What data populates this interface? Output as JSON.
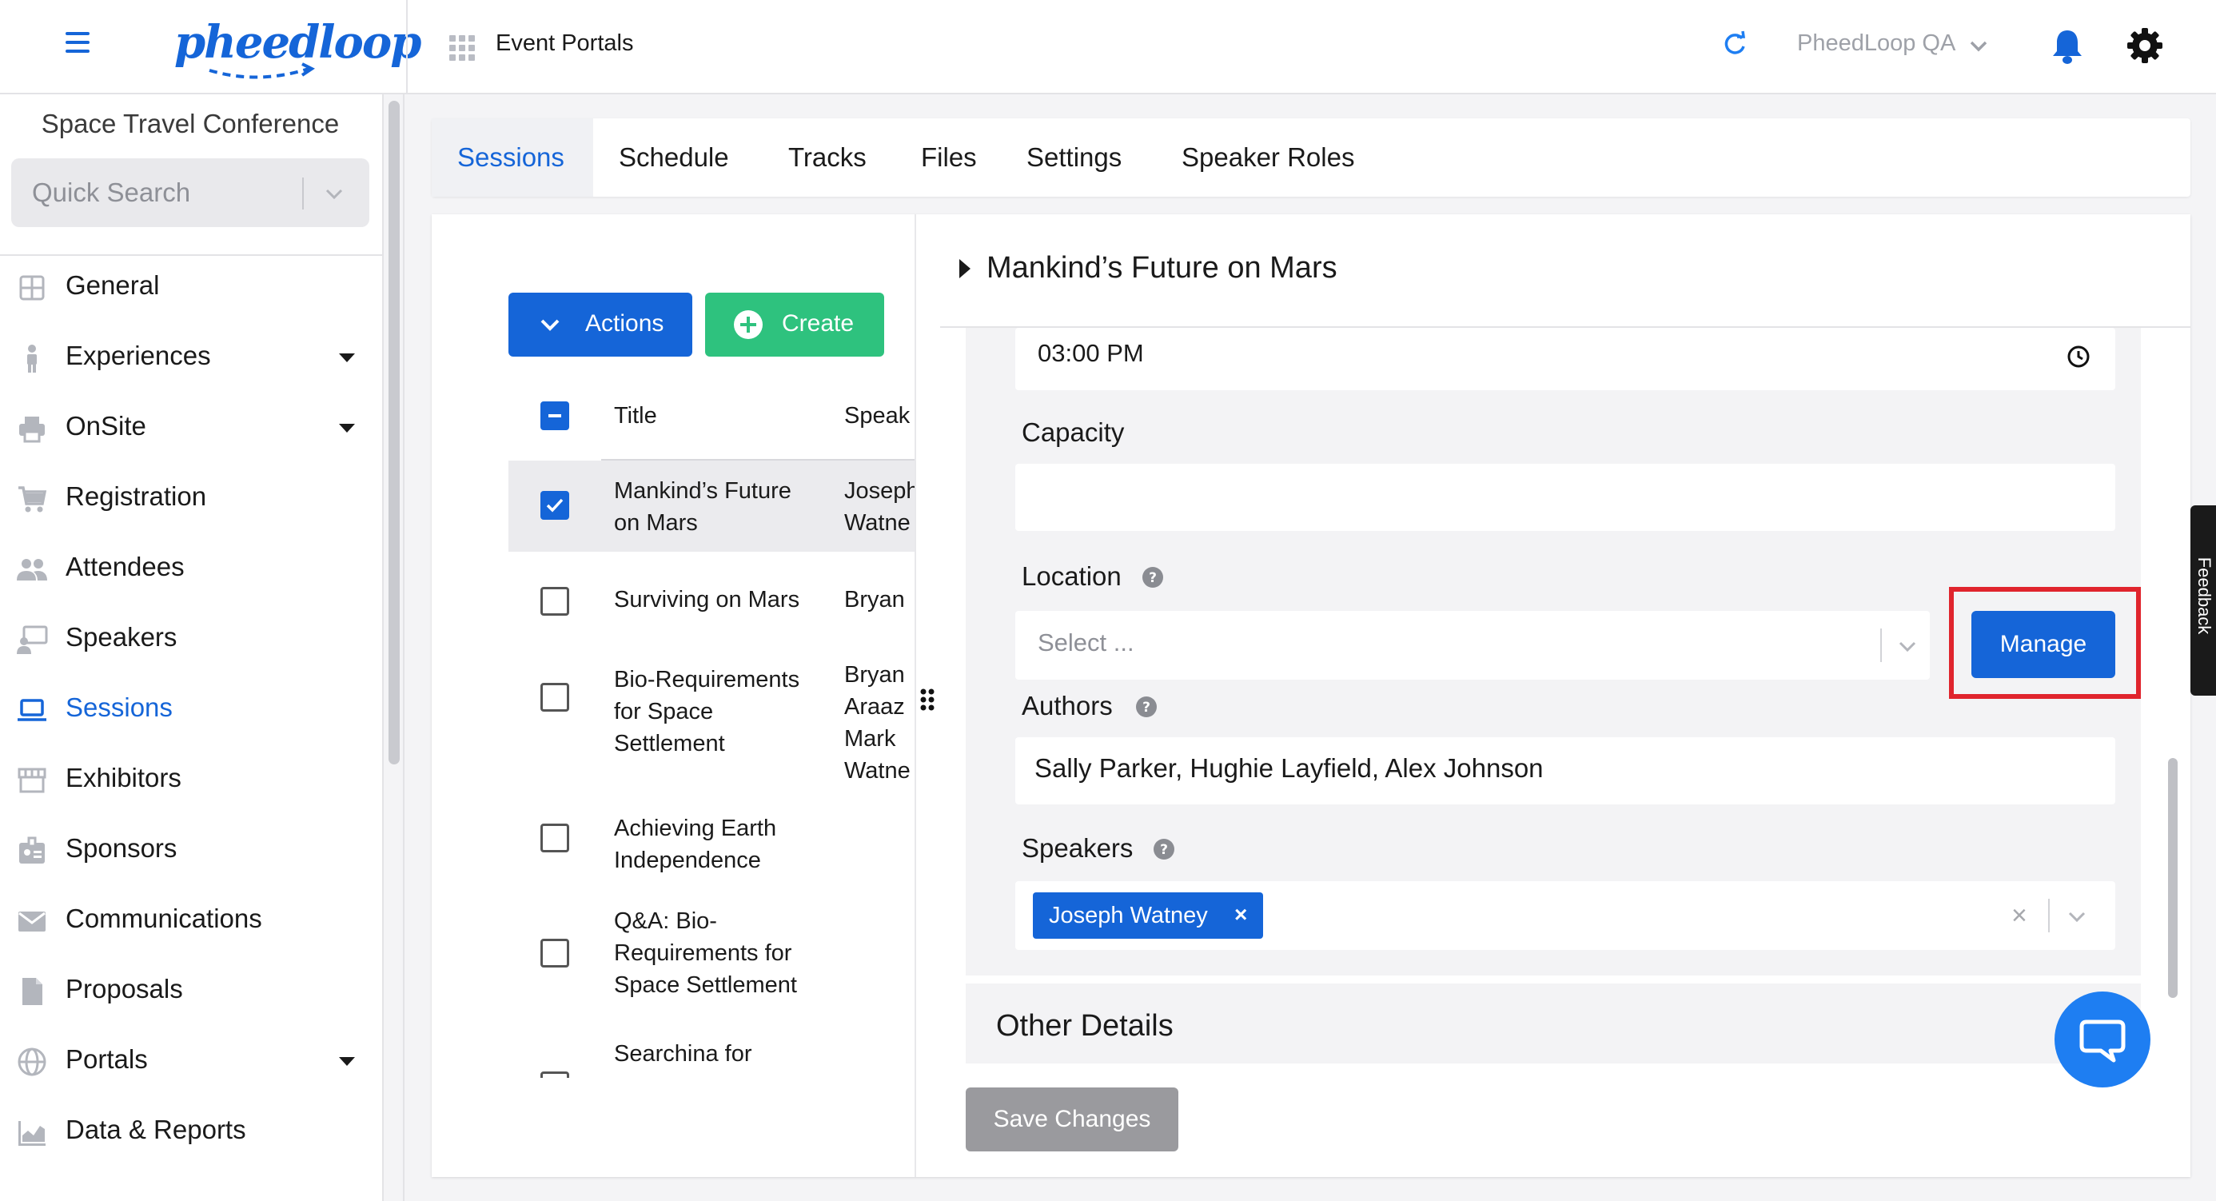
{
  "topbar": {
    "logo_text": "pheedloop",
    "portal_title": "Event Portals",
    "org_name": "PheedLoop QA"
  },
  "sidebar": {
    "event_name": "Space Travel Conference",
    "quick_search_placeholder": "Quick Search",
    "items": [
      {
        "label": "General",
        "icon": "grid-icon",
        "has_caret": false
      },
      {
        "label": "Experiences",
        "icon": "person-icon",
        "has_caret": true
      },
      {
        "label": "OnSite",
        "icon": "printer-icon",
        "has_caret": true
      },
      {
        "label": "Registration",
        "icon": "cart-icon",
        "has_caret": false
      },
      {
        "label": "Attendees",
        "icon": "people-icon",
        "has_caret": false
      },
      {
        "label": "Speakers",
        "icon": "presenter-icon",
        "has_caret": false
      },
      {
        "label": "Sessions",
        "icon": "laptop-icon",
        "has_caret": false,
        "active": true
      },
      {
        "label": "Exhibitors",
        "icon": "storefront-icon",
        "has_caret": false
      },
      {
        "label": "Sponsors",
        "icon": "badge-icon",
        "has_caret": false
      },
      {
        "label": "Communications",
        "icon": "envelope-icon",
        "has_caret": false
      },
      {
        "label": "Proposals",
        "icon": "document-icon",
        "has_caret": false
      },
      {
        "label": "Portals",
        "icon": "globe-icon",
        "has_caret": true
      },
      {
        "label": "Data & Reports",
        "icon": "chart-icon",
        "has_caret": false
      }
    ]
  },
  "tabs": [
    "Sessions",
    "Schedule",
    "Tracks",
    "Files",
    "Settings",
    "Speaker Roles"
  ],
  "list": {
    "actions_label": "Actions",
    "create_label": "Create",
    "col_title": "Title",
    "col_speaker": "Speak",
    "rows": [
      {
        "title": "Mankind’s Future\non Mars",
        "speaker": "Joseph\nWatne",
        "checked": true
      },
      {
        "title": "Surviving on Mars",
        "speaker": "Bryan",
        "checked": false
      },
      {
        "title": "Bio-Requirements\nfor Space\nSettlement",
        "speaker": "Bryan\nAraaz\nMark\nWatne",
        "checked": false
      },
      {
        "title": "Achieving Earth\nIndependence",
        "speaker": "",
        "checked": false
      },
      {
        "title": "Q&A: Bio-\nRequirements for\nSpace Settlement",
        "speaker": "",
        "checked": false
      },
      {
        "title": "Searchina for",
        "speaker": "",
        "checked": false
      }
    ]
  },
  "detail": {
    "session_title": "Mankind’s Future on Mars",
    "end_time": "03:00  PM",
    "capacity_label": "Capacity",
    "capacity_value": "",
    "location_label": "Location",
    "location_placeholder": "Select ...",
    "manage_label": "Manage",
    "authors_label": "Authors",
    "authors_value": "Sally Parker, Hughie Layfield, Alex Johnson",
    "speakers_label": "Speakers",
    "speaker_chip": "Joseph Watney",
    "chip_remove": "×",
    "clear_all": "×",
    "other_details_label": "Other Details",
    "save_label": "Save Changes"
  },
  "feedback_label": "Feedback",
  "colors": {
    "primary": "#1565d8",
    "create_green": "#2ec27e",
    "highlight_red": "#e0242d",
    "save_disabled": "#9a9a9e"
  }
}
